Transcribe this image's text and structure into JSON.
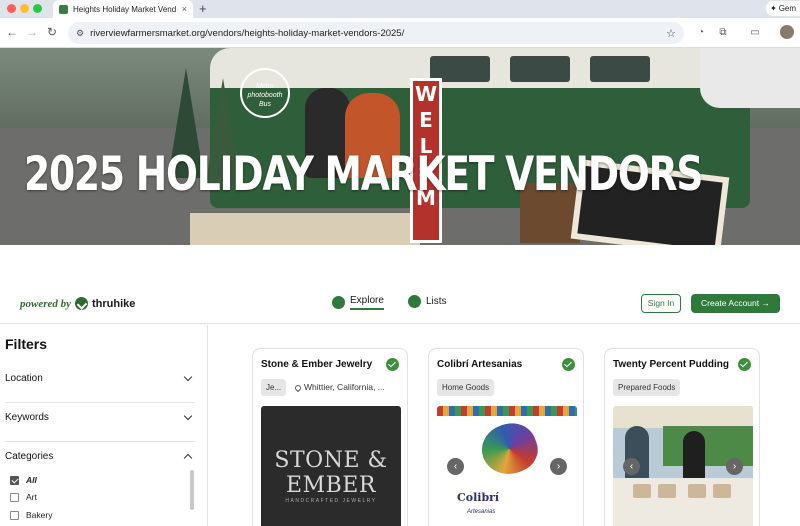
{
  "browser": {
    "tab_title": "Heights Holiday Market Vend",
    "tab_close": "×",
    "new_tab": "+",
    "url": "riverviewfarmersmarket.org/vendors/heights-holiday-market-vendors-2025/",
    "gemini_label": "Gem",
    "traffic_colors": [
      "#ff5f57",
      "#febc2e",
      "#28c840"
    ],
    "icons": [
      "back-icon",
      "forward-icon",
      "reload-icon",
      "site-settings-icon",
      "bookmark-star-icon",
      "extension-icon",
      "puzzle-icon",
      "media-icon",
      "profile-avatar"
    ]
  },
  "hero": {
    "title": "2025 HOLIDAY MARKET VENDORS",
    "sign_letters": [
      "W",
      "E",
      "L",
      "❄",
      "M"
    ],
    "bus_text": "Metro photobooth Bus"
  },
  "nav": {
    "powered_by": "powered by",
    "brand": "thruhike",
    "explore": "Explore",
    "lists": "Lists",
    "sign_in": "Sign In",
    "create_account": "Create Account",
    "create_account_arrow": "→",
    "accent_color": "#2f7a3a"
  },
  "filters": {
    "title": "Filters",
    "sections": [
      {
        "label": "Location",
        "expanded": false
      },
      {
        "label": "Keywords",
        "expanded": false
      },
      {
        "label": "Categories",
        "expanded": true
      }
    ],
    "categories": [
      {
        "label": "All",
        "checked": true
      },
      {
        "label": "Art",
        "checked": false
      },
      {
        "label": "Bakery",
        "checked": false
      }
    ]
  },
  "vendors": [
    {
      "name": "Stone & Ember Jewelry",
      "chip": "Je...",
      "location": "Whittier, California, ...",
      "logo_line1": "STONE &",
      "logo_line2": "EMBER",
      "logo_sub": "HANDCRAFTED JEWELRY",
      "verified": true
    },
    {
      "name": "Colibrí Artesanias",
      "chip": "Home Goods",
      "logo_text": "Colibrí",
      "logo_sub": "Artesanias",
      "verified": true
    },
    {
      "name": "Twenty Percent Pudding",
      "chip": "Prepared Foods",
      "verified": true
    }
  ]
}
